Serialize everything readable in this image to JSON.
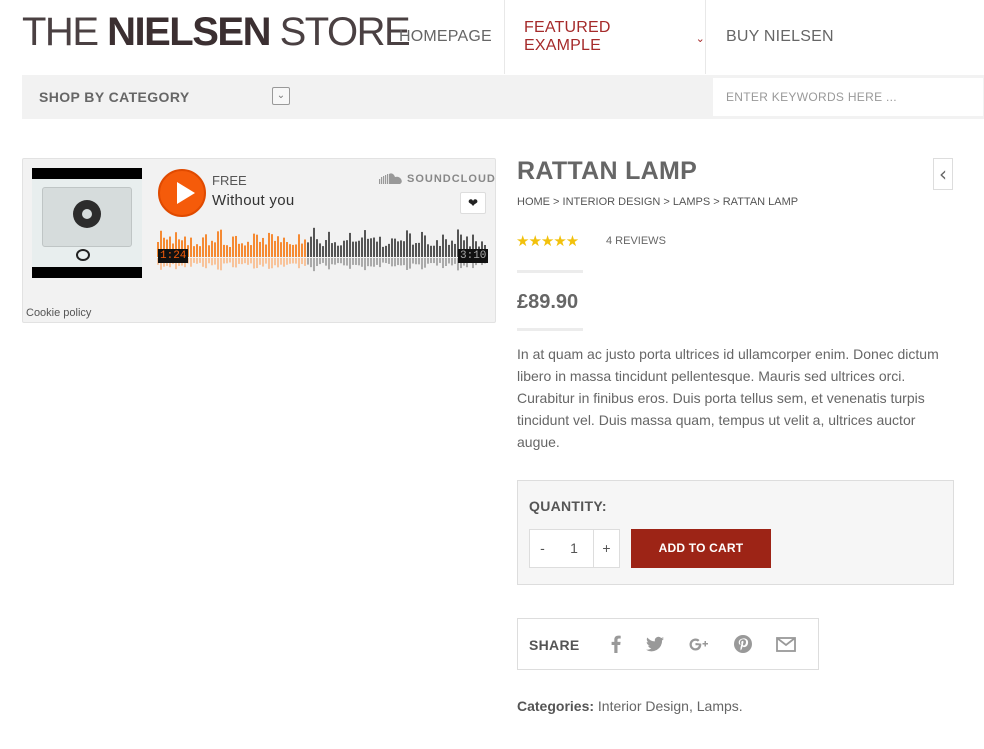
{
  "header": {
    "logo_part1": "THE ",
    "logo_part2": "NIELSEN",
    "logo_part3": " STORE",
    "nav": {
      "homepage": "HOMEPAGE",
      "featured": "FEATURED EXAMPLE",
      "buy": "BUY NIELSEN"
    }
  },
  "category_bar": {
    "label": "SHOP BY CATEGORY",
    "search_placeholder": "ENTER KEYWORDS HERE ..."
  },
  "player": {
    "free_label": "FREE",
    "track_title": "Without you",
    "brand": "SOUNDCLOUD",
    "current_time": "1:24",
    "duration": "3:10",
    "played_fraction": 0.45,
    "cookie_link": "Cookie policy",
    "accent_color": "#f55b0a"
  },
  "product": {
    "title": "RATTAN LAMP",
    "breadcrumb": [
      "HOME",
      "INTERIOR DESIGN",
      "LAMPS",
      "RATTAN LAMP"
    ],
    "breadcrumb_sep": " > ",
    "rating": 5,
    "stars": "★★★★★",
    "reviews": "4 REVIEWS",
    "price": "£89.90",
    "description": "In at quam ac justo porta ultrices id ullamcorper enim. Donec dictum libero in massa tincidunt pellentesque. Mauris sed ultrices orci. Curabitur in finibus eros. Duis porta tellus sem, et venenatis turpis tincidunt vel. Duis massa quam, tempus ut velit a, ultrices auctor augue.",
    "quantity_label": "QUANTITY:",
    "minus": "-",
    "quantity": "1",
    "plus": "+",
    "add_to_cart": "ADD TO CART",
    "share_label": "SHARE",
    "share_icons": [
      "facebook-icon",
      "twitter-icon",
      "google-plus-icon",
      "pinterest-icon",
      "email-icon"
    ],
    "categories_label": "Categories:",
    "categories": " Interior Design, Lamps.",
    "brand_color": "#9d2416"
  }
}
